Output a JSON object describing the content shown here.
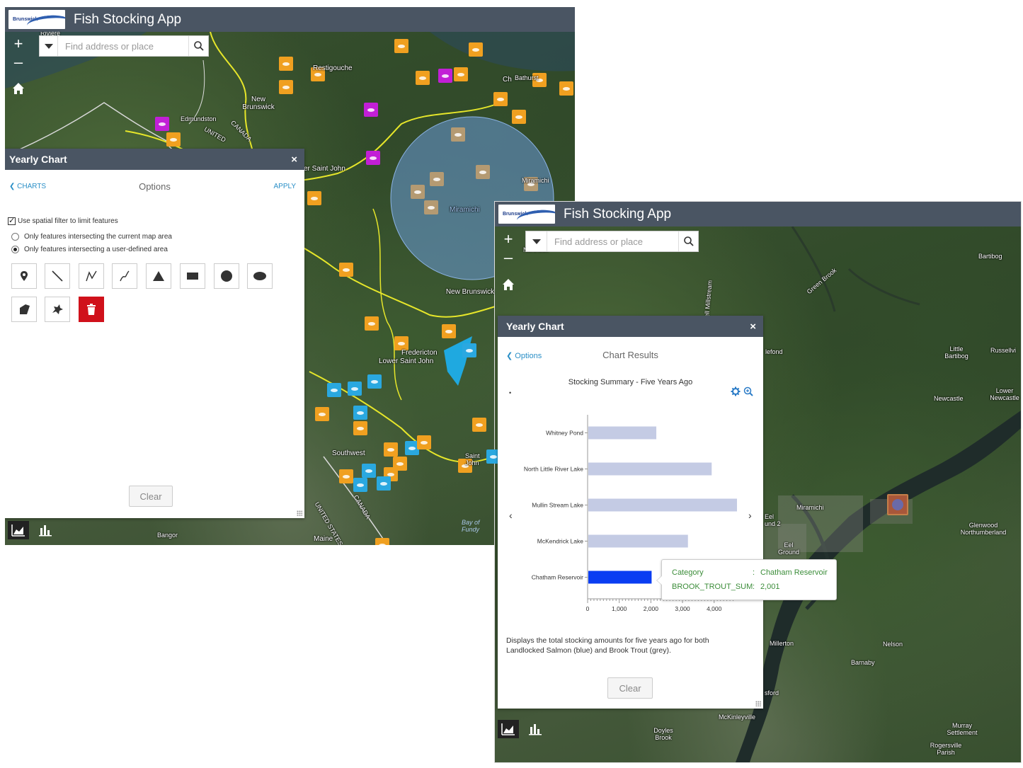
{
  "app1": {
    "title": "Fish Stocking App",
    "logo_text": "Brunswick",
    "search": {
      "placeholder": "Find address or place"
    },
    "zoom_in": "+",
    "zoom_out": "–",
    "map_labels": [
      "Riviere",
      "Restigouche",
      "Bathurst",
      "New Brunswick",
      "Edmundston",
      "UNITED",
      "CANADA",
      "er Saint John",
      "Miramichi",
      "Miramichi",
      "New Brunswick",
      "Fredericton",
      "Lower Saint John",
      "Southwest",
      "Saint John",
      "Bay of Fundy",
      "UNITED STATES",
      "CANADA",
      "Bangor",
      "Maine",
      "Ch"
    ],
    "panel": {
      "title": "Yearly Chart",
      "close": "×",
      "back": "CHARTS",
      "section": "Options",
      "apply": "APPLY",
      "spatial_filter_label": "Use spatial filter to limit features",
      "option_current_map": "Only features intersecting the current map area",
      "option_user_area": "Only features intersecting a user-defined area",
      "tools": [
        "point-tool",
        "line-tool",
        "polyline-tool",
        "freehand-line-tool",
        "triangle-tool",
        "rectangle-tool",
        "circle-tool",
        "ellipse-tool",
        "polygon-tool",
        "freehand-polygon-tool",
        "delete-tool"
      ],
      "clear": "Clear"
    }
  },
  "app2": {
    "title": "Fish Stocking App",
    "logo_text": "Brunswick",
    "search": {
      "placeholder": "Find address or place"
    },
    "zoom_in": "+",
    "zoom_out": "–",
    "map_labels": [
      "Bartibog",
      "Little Bartibog",
      "Russellvi",
      "Lower Newcastle",
      "Newcastle",
      "Miramichi",
      "Glenwood Northumberland",
      "Eel Ground",
      "Millerton",
      "Nelson",
      "Barnaby",
      "McKinleyville",
      "Doyles Brook",
      "Murray Settlement",
      "Rogersville Parish",
      "Green Brook",
      "Bell Millstream",
      "lefond",
      "Eel und 2",
      "sford",
      "Northesk"
    ],
    "panel": {
      "title": "Yearly Chart",
      "close": "×",
      "back": "Options",
      "section": "Chart Results",
      "description": "Displays the total stocking amounts for five years ago for both Landlocked Salmon (blue) and Brook Trout (grey).",
      "clear": "Clear",
      "nav_prev": "‹",
      "nav_next": "›",
      "dot": "•",
      "tooltip": {
        "category_label": "Category",
        "category_value": "Chatham Reservoir",
        "metric_label": "BROOK_TROUT_SUM",
        "metric_value": "2,001",
        "sep": ":"
      }
    }
  },
  "chart_data": {
    "type": "bar",
    "orientation": "horizontal",
    "title": "Stocking Summary - Five Years Ago",
    "categories": [
      "Whitney Pond",
      "North Little River Lake",
      "Mullin Stream Lake",
      "McKendrick Lake",
      "Chatham Reservoir"
    ],
    "values": [
      2150,
      3900,
      4700,
      3150,
      2001
    ],
    "highlighted": "Chatham Reservoir",
    "xticks": [
      0,
      1000,
      2000,
      3000,
      4000
    ],
    "xtick_labels": [
      "0",
      "1,000",
      "2,000",
      "3,000",
      "4,000"
    ],
    "xlim": [
      0,
      4700
    ],
    "colors": {
      "bar": "#c4cbe4",
      "highlight": "#0a3df2"
    },
    "grid": false
  },
  "colors": {
    "header": "#4a5563",
    "accent_link": "#2a8fc7",
    "marker_orange": "#f0a020",
    "marker_purple": "#c21fd6",
    "marker_blue": "#2aa8e0",
    "marker_tan": "#b49a72",
    "boundary": "#e6e62a",
    "delete": "#d0111b"
  }
}
